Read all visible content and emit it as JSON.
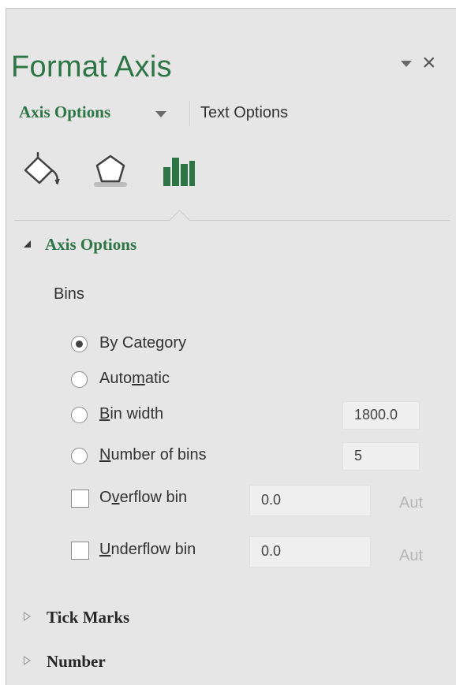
{
  "pane": {
    "title": "Format Axis",
    "close_glyph": "×",
    "tabs": {
      "axis_options": "Axis Options",
      "text_options": "Text Options"
    },
    "icons": [
      "fill-line-icon",
      "effects-icon",
      "axis-options-icon"
    ]
  },
  "colors": {
    "accent": "#2e7546",
    "pane_bg": "#e6e6e6"
  },
  "axis_options": {
    "header": "Axis Options",
    "bins_label": "Bins",
    "options": {
      "by_category": {
        "pre": "By Cate",
        "u": "g",
        "post": "ory"
      },
      "automatic": {
        "pre": "Auto",
        "u": "m",
        "post": "atic"
      },
      "bin_width": {
        "pre": "",
        "u": "B",
        "post": "in width",
        "value": "1800.0"
      },
      "number_of_bins": {
        "pre": "",
        "u": "N",
        "post": "umber of bins",
        "value": "5"
      },
      "overflow_bin": {
        "pre": "O",
        "u": "v",
        "post": "erflow bin",
        "value": "0.0",
        "auto": "Auto"
      },
      "underflow_bin": {
        "pre": "",
        "u": "U",
        "post": "nderflow bin",
        "value": "0.0",
        "auto": "Auto"
      }
    },
    "selected": "by_category"
  },
  "sections": {
    "tick_marks": "Tick Marks",
    "number": "Number"
  }
}
